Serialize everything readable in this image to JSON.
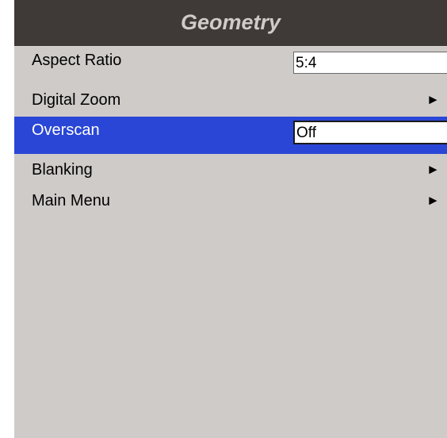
{
  "menu": {
    "title": "Geometry",
    "items": [
      {
        "label": "Aspect Ratio",
        "value": "5:4"
      },
      {
        "label": "Digital Zoom",
        "arrow": "►"
      },
      {
        "label": "Overscan",
        "value": "Off",
        "selected": true
      },
      {
        "label": "Blanking",
        "arrow": "►"
      },
      {
        "label": "Main Menu",
        "arrow": "►"
      }
    ]
  },
  "colors": {
    "title_background": "#3f3a38",
    "title_text": "#cfcbc9",
    "menu_background": "#cfcbc9",
    "selection_highlight": "#2a46d6"
  },
  "icons": {
    "submenu": "arrow-right-icon"
  }
}
